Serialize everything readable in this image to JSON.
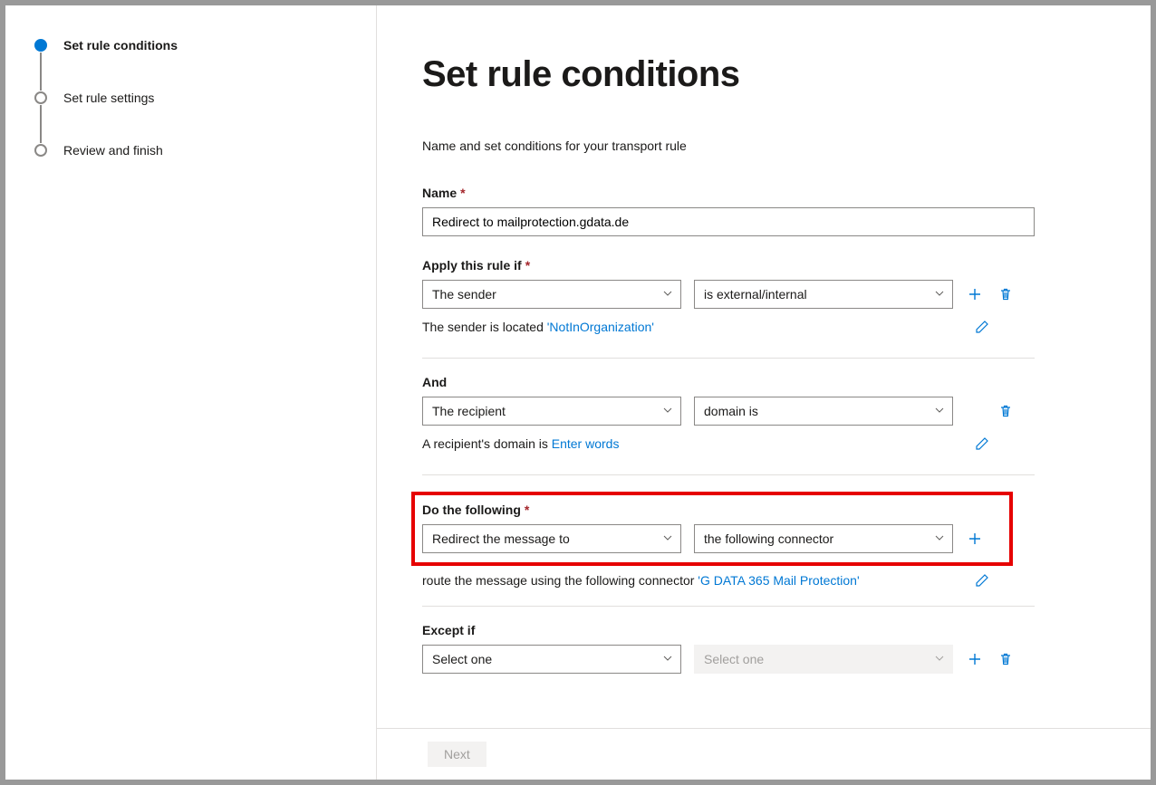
{
  "steps": [
    {
      "label": "Set rule conditions",
      "active": true
    },
    {
      "label": "Set rule settings",
      "active": false
    },
    {
      "label": "Review and finish",
      "active": false
    }
  ],
  "page": {
    "title": "Set rule conditions",
    "subtitle": "Name and set conditions for your transport rule"
  },
  "name_field": {
    "label": "Name",
    "value": "Redirect to mailprotection.gdata.de"
  },
  "apply_if": {
    "label": "Apply this rule if",
    "select_a": "The sender",
    "select_b": "is external/internal",
    "helper_prefix": "The sender is located ",
    "helper_link": "'NotInOrganization'"
  },
  "and_block": {
    "label": "And",
    "select_a": "The recipient",
    "select_b": "domain is",
    "helper_prefix": "A recipient's domain is ",
    "helper_link": "Enter words"
  },
  "do_block": {
    "label": "Do the following",
    "select_a": "Redirect the message to",
    "select_b": "the following connector",
    "helper_prefix": "route the message using the following connector ",
    "helper_link": "'G DATA 365 Mail Protection'"
  },
  "except_block": {
    "label": "Except if",
    "select_a": "Select one",
    "select_b_placeholder": "Select one"
  },
  "footer": {
    "next": "Next"
  }
}
